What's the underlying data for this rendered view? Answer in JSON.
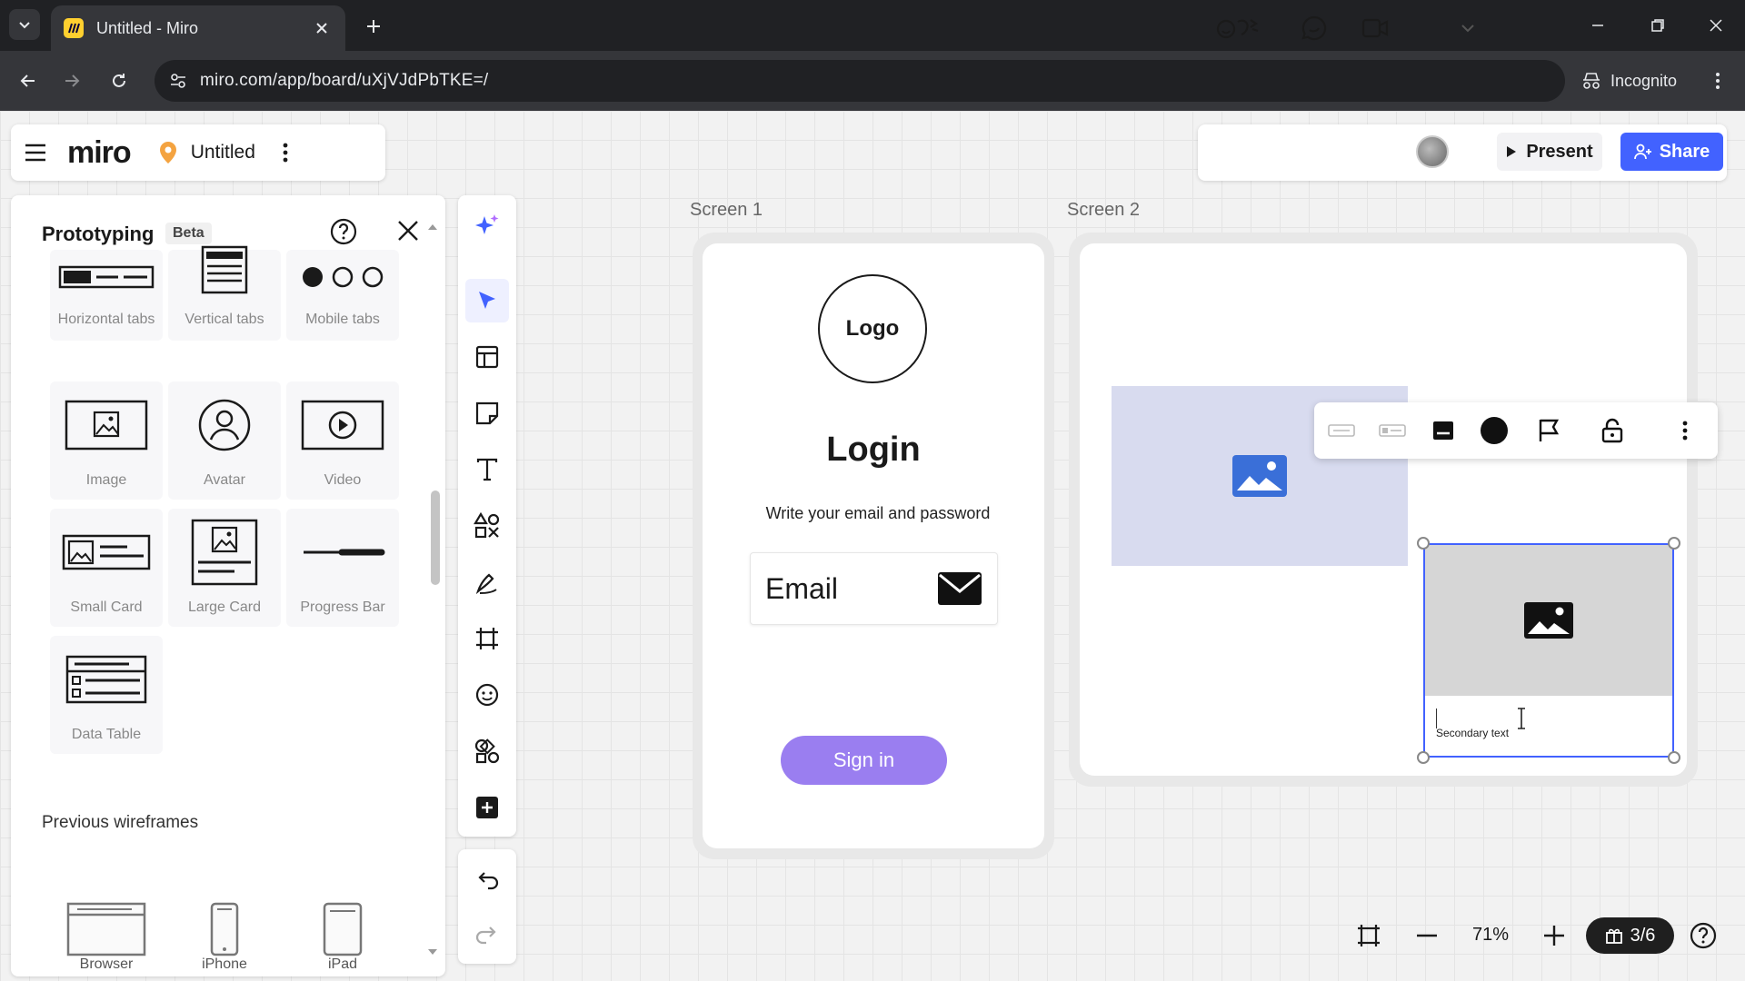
{
  "browser": {
    "tab_title": "Untitled - Miro",
    "url": "miro.com/app/board/uXjVJdPbTKE=/",
    "incognito_label": "Incognito"
  },
  "miro": {
    "logo": "miro",
    "board_name": "Untitled",
    "present_label": "Present",
    "share_label": "Share",
    "accent": "#4262ff"
  },
  "panel": {
    "title": "Prototyping",
    "badge": "Beta",
    "components": [
      {
        "label": "Horizontal tabs",
        "icon": "horizontal-tabs-icon"
      },
      {
        "label": "Vertical tabs",
        "icon": "vertical-tabs-icon"
      },
      {
        "label": "Mobile tabs",
        "icon": "mobile-tabs-icon"
      },
      {
        "label": "Image",
        "icon": "image-icon"
      },
      {
        "label": "Avatar",
        "icon": "avatar-icon"
      },
      {
        "label": "Video",
        "icon": "video-icon"
      },
      {
        "label": "Small Card",
        "icon": "small-card-icon"
      },
      {
        "label": "Large Card",
        "icon": "large-card-icon"
      },
      {
        "label": "Progress Bar",
        "icon": "progress-bar-icon"
      },
      {
        "label": "Data Table",
        "icon": "data-table-icon"
      }
    ],
    "previous_title": "Previous wireframes",
    "previous": [
      {
        "label": "Browser",
        "icon": "browser-icon"
      },
      {
        "label": "iPhone",
        "icon": "iphone-icon"
      },
      {
        "label": "iPad",
        "icon": "ipad-icon"
      }
    ]
  },
  "canvas": {
    "screen1": {
      "label": "Screen 1",
      "logo_text": "Logo",
      "title": "Login",
      "subtitle": "Write your email and password",
      "email_value": "Email",
      "signin_label": "Sign in",
      "button_color": "#9a7ef0"
    },
    "screen2": {
      "label": "Screen 2",
      "card_secondary_text": "Secondary text"
    }
  },
  "zoom": {
    "value": "71%",
    "pages": "3/6"
  }
}
